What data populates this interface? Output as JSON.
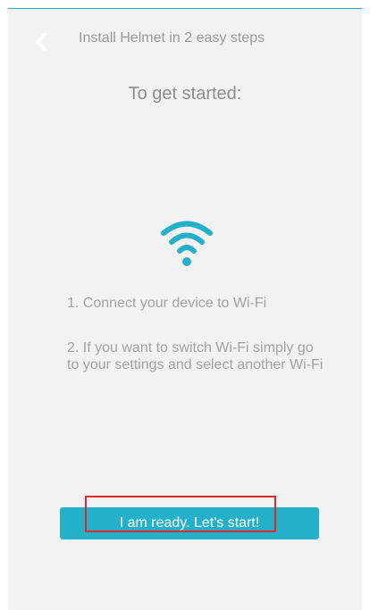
{
  "header": {
    "title": "Install Helmet in 2 easy steps",
    "back_icon": "chevron-left-icon"
  },
  "main": {
    "subtitle": "To get started:",
    "wifi_icon": "wifi-icon",
    "steps": [
      "1. Connect your device to Wi-Fi",
      "2. If you want to switch Wi-Fi simply go to your settings and select another Wi-Fi"
    ]
  },
  "actions": {
    "start_label": "I am ready. Let's start!"
  },
  "colors": {
    "accent": "#25b0c9",
    "background": "#f2f2f2",
    "highlight": "#e0262e"
  }
}
